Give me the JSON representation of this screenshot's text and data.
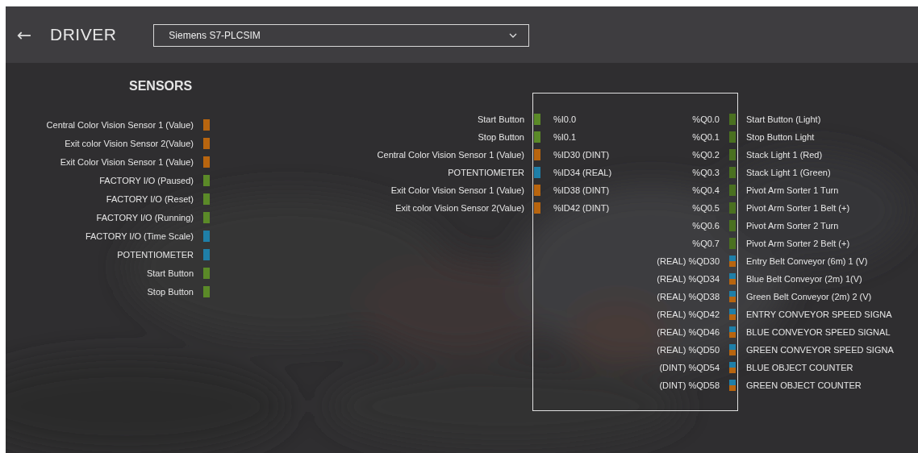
{
  "header": {
    "back": "←",
    "title": "DRIVER",
    "driver_select": {
      "value": "Siemens S7-PLCSIM"
    }
  },
  "sensors": {
    "title": "SENSORS",
    "items": [
      {
        "label": "Central Color Vision Sensor 1 (Value)",
        "color": "#b8650f"
      },
      {
        "label": "Exit color Vision Sensor 2(Value)",
        "color": "#b8650f"
      },
      {
        "label": "Exit Color Vision Sensor 1 (Value)",
        "color": "#b8650f"
      },
      {
        "label": "FACTORY I/O (Paused)",
        "color": "#5b8a28"
      },
      {
        "label": "FACTORY I/O (Reset)",
        "color": "#5b8a28"
      },
      {
        "label": "FACTORY I/O (Running)",
        "color": "#5b8a28"
      },
      {
        "label": "FACTORY I/O (Time Scale)",
        "color": "#1f7fa8"
      },
      {
        "label": "POTENTIOMETER",
        "color": "#1f7fa8"
      },
      {
        "label": "Start Button",
        "color": "#5b8a28"
      },
      {
        "label": "Stop Button",
        "color": "#5b8a28"
      }
    ]
  },
  "inputs": [
    {
      "label": "Start Button",
      "address": "%I0.0",
      "color": "#5b8a28"
    },
    {
      "label": "Stop Button",
      "address": "%I0.1",
      "color": "#5b8a28"
    },
    {
      "label": "Central Color Vision Sensor 1 (Value)",
      "address": "%ID30 (DINT)",
      "color": "#b8650f"
    },
    {
      "label": "POTENTIOMETER",
      "address": "%ID34 (REAL)",
      "color": "#1f7fa8"
    },
    {
      "label": "Exit Color Vision Sensor 1 (Value)",
      "address": "%ID38 (DINT)",
      "color": "#b8650f"
    },
    {
      "label": "Exit color Vision Sensor 2(Value)",
      "address": "%ID42 (DINT)",
      "color": "#b8650f"
    }
  ],
  "outputs": [
    {
      "address": "%Q0.0",
      "label": "Start Button  (Light)",
      "kind": "single",
      "color": "#4a7020"
    },
    {
      "address": "%Q0.1",
      "label": "Stop Button Light",
      "kind": "single",
      "color": "#4a7020"
    },
    {
      "address": "%Q0.2",
      "label": "Stack Light 1 (Red)",
      "kind": "single",
      "color": "#4a7020"
    },
    {
      "address": "%Q0.3",
      "label": "Stack Light 1 (Green)",
      "kind": "single",
      "color": "#4a7020"
    },
    {
      "address": "%Q0.4",
      "label": "Pivot Arm Sorter 1 Turn",
      "kind": "single",
      "color": "#4a7020"
    },
    {
      "address": "%Q0.5",
      "label": "Pivot Arm Sorter 1 Belt (+)",
      "kind": "single",
      "color": "#4a7020"
    },
    {
      "address": "%Q0.6",
      "label": "Pivot Arm Sorter 2 Turn",
      "kind": "single",
      "color": "#4a7020"
    },
    {
      "address": "%Q0.7",
      "label": "Pivot Arm Sorter 2 Belt (+)",
      "kind": "single",
      "color": "#4a7020"
    },
    {
      "address": "(REAL) %QD30",
      "label": "Entry Belt Conveyor (6m) 1 (V)",
      "kind": "split",
      "swatch": [
        {
          "color": "#1f7fa8"
        },
        {
          "color": "#b8650f"
        }
      ]
    },
    {
      "address": "(REAL) %QD34",
      "label": "Blue Belt Conveyor (2m) 1(V)",
      "kind": "split",
      "swatch": [
        {
          "color": "#1f7fa8"
        },
        {
          "color": "#b8650f"
        }
      ]
    },
    {
      "address": "(REAL) %QD38",
      "label": "Green Belt Conveyor (2m) 2 (V)",
      "kind": "split",
      "swatch": [
        {
          "color": "#1f7fa8"
        },
        {
          "color": "#b8650f"
        }
      ]
    },
    {
      "address": "(REAL) %QD42",
      "label": "ENTRY CONVEYOR SPEED SIGNA",
      "kind": "split",
      "swatch": [
        {
          "color": "#1f7fa8"
        },
        {
          "color": "#b8650f"
        }
      ]
    },
    {
      "address": "(REAL) %QD46",
      "label": "BLUE CONVEYOR SPEED SIGNAL",
      "kind": "split",
      "swatch": [
        {
          "color": "#1f7fa8"
        },
        {
          "color": "#b8650f"
        }
      ]
    },
    {
      "address": "(REAL) %QD50",
      "label": "GREEN  CONVEYOR SPEED SIGNA",
      "kind": "split",
      "swatch": [
        {
          "color": "#1f7fa8"
        },
        {
          "color": "#b8650f"
        }
      ]
    },
    {
      "address": "(DINT) %QD54",
      "label": "BLUE OBJECT COUNTER",
      "kind": "split",
      "swatch": [
        {
          "color": "#1f7fa8"
        },
        {
          "color": "#b8650f"
        }
      ]
    },
    {
      "address": "(DINT) %QD58",
      "label": "GREEN OBJECT COUNTER",
      "kind": "split",
      "swatch": [
        {
          "color": "#1f7fa8"
        },
        {
          "color": "#b8650f"
        }
      ]
    }
  ]
}
